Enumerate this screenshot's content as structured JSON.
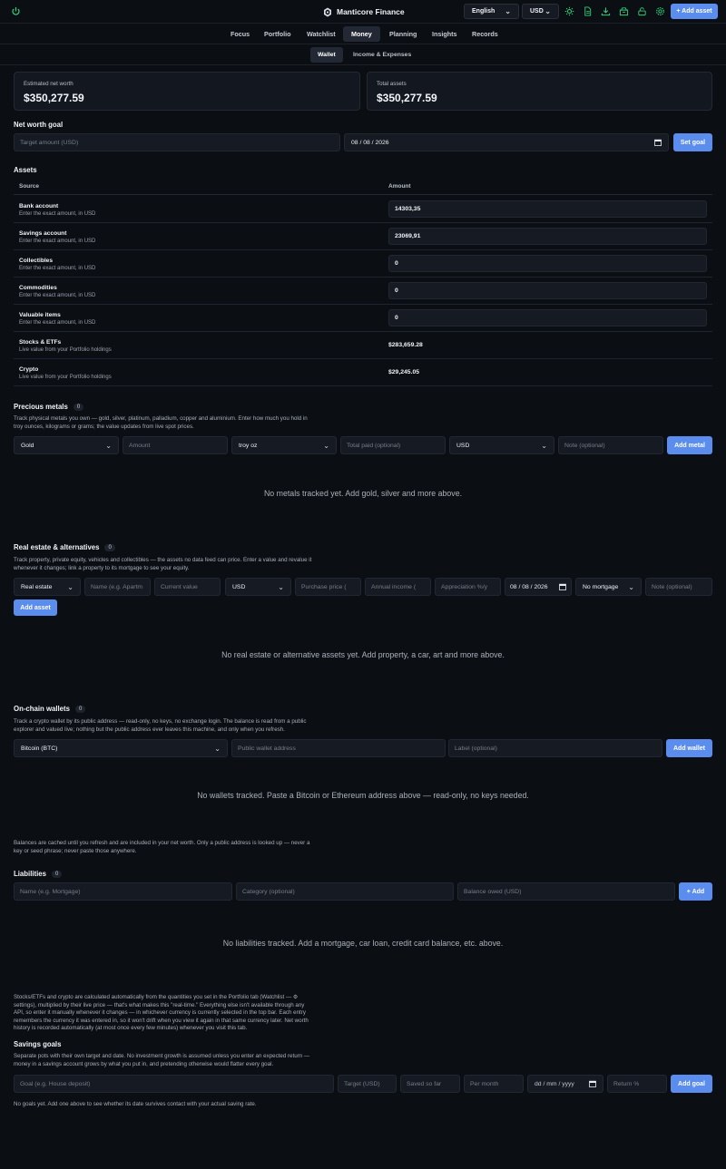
{
  "app": {
    "title": "Manticore Finance",
    "language": "English",
    "currency": "USD",
    "add_asset": "+ Add asset",
    "icons": [
      "power-icon",
      "theme-sun-icon",
      "document-icon",
      "download-icon",
      "inbox-icon",
      "lock-icon",
      "settings-icon"
    ],
    "accent_color": "#5b8def",
    "icon_color": "#2fd27a"
  },
  "nav": {
    "tabs": [
      "Focus",
      "Portfolio",
      "Watchlist",
      "Money",
      "Planning",
      "Insights",
      "Records"
    ],
    "active": "Money",
    "subtabs": [
      "Wallet",
      "Income & Expenses"
    ],
    "active_sub": "Wallet"
  },
  "summary": {
    "net_worth_label": "Estimated net worth",
    "net_worth_value": "$350,277.59",
    "total_assets_label": "Total assets",
    "total_assets_value": "$350,277.59"
  },
  "goal": {
    "title": "Net worth goal",
    "amount_placeholder": "Target amount (USD)",
    "date": "08 / 08 / 2026",
    "button": "Set goal"
  },
  "assets": {
    "title": "Assets",
    "col_source": "Source",
    "col_amount": "Amount",
    "rows": [
      {
        "name": "Bank account",
        "hint": "Enter the exact amount, in USD",
        "value": "14303,35"
      },
      {
        "name": "Savings account",
        "hint": "Enter the exact amount, in USD",
        "value": "23069,91"
      },
      {
        "name": "Collectibles",
        "hint": "Enter the exact amount, in USD",
        "value": "0"
      },
      {
        "name": "Commodities",
        "hint": "Enter the exact amount, in USD",
        "value": "0"
      },
      {
        "name": "Valuable items",
        "hint": "Enter the exact amount, in USD",
        "value": "0"
      },
      {
        "name": "Stocks & ETFs",
        "hint": "Live value from your Portfolio holdings",
        "value": "$283,659.28"
      },
      {
        "name": "Crypto",
        "hint": "Live value from your Portfolio holdings",
        "value": "$29,245.05"
      }
    ]
  },
  "metals": {
    "title": "Precious metals",
    "count": "0",
    "desc1": "Track physical metals you own — gold, silver, platinum, palladium, copper and aluminium. Enter how much you hold in",
    "desc2": "troy ounces, kilograms or grams; the value updates from live spot prices.",
    "metal": "Gold",
    "amount_placeholder": "Amount",
    "unit": "troy oz",
    "paid_placeholder": "Total paid (optional)",
    "currency": "USD",
    "note_placeholder": "Note (optional)",
    "button": "Add metal",
    "empty": "No metals tracked yet. Add gold, silver and more above."
  },
  "realestate": {
    "title": "Real estate & alternatives",
    "count": "0",
    "desc1": "Track property, private equity, vehicles and collectibles — the assets no data feed can price. Enter a value and revalue it",
    "desc2": "whenever it changes; link a property to its mortgage to see your equity.",
    "type": "Real estate",
    "name_placeholder": "Name (e.g. Apartm",
    "value_placeholder": "Current value",
    "currency": "USD",
    "purchase_placeholder": "Purchase price (",
    "income_placeholder": "Annual income (",
    "appreciation_placeholder": "Appreciation %/y",
    "date": "08 / 08 / 2026",
    "mortgage": "No mortgage",
    "note_placeholder": "Note (optional)",
    "button": "Add asset",
    "empty": "No real estate or alternative assets yet. Add property, a car, art and more above."
  },
  "wallets": {
    "title": "On-chain wallets",
    "count": "0",
    "desc1": "Track a crypto wallet by its public address — read-only, no keys, no exchange login. The balance is read from a public",
    "desc2": "explorer and valued live; nothing but the public address ever leaves this machine, and only when you refresh.",
    "chain": "Bitcoin (BTC)",
    "address_placeholder": "Public wallet address",
    "label_placeholder": "Label (optional)",
    "button": "Add wallet",
    "empty": "No wallets tracked. Paste a Bitcoin or Ethereum address above — read-only, no keys needed.",
    "note1": "Balances are cached until you refresh and are included in your net worth. Only a public address is looked up — never a",
    "note2": "key or seed phrase; never paste those anywhere."
  },
  "liabilities": {
    "title": "Liabilities",
    "count": "0",
    "name_placeholder": "Name (e.g. Mortgage)",
    "category_placeholder": "Category (optional)",
    "balance_placeholder": "Balance owed (USD)",
    "button": "+ Add",
    "empty": "No liabilities tracked. Add a mortgage, car loan, credit card balance, etc. above."
  },
  "footnote": {
    "l1": "Stocks/ETFs and crypto are calculated automatically from the quantities you set in the Portfolio tab (Watchlist — ⚙",
    "l2": "settings), multiplied by their live price — that's what makes this \"real-time.\" Everything else isn't available through any",
    "l3": "API, so enter it manually whenever it changes — in whichever currency is currently selected in the top bar. Each entry",
    "l4": "remembers the currency it was entered in, so it won't drift when you view it again in that same currency later. Net worth",
    "l5": "history is recorded automatically (at most once every few minutes) whenever you visit this tab."
  },
  "savings": {
    "title": "Savings goals",
    "desc1": "Separate pots with their own target and date. No investment growth is assumed unless you enter an expected return —",
    "desc2": "money in a savings account grows by what you put in, and pretending otherwise would flatter every goal.",
    "goal_placeholder": "Goal (e.g. House deposit)",
    "target_placeholder": "Target (USD)",
    "saved_placeholder": "Saved so far",
    "month_placeholder": "Per month",
    "date_placeholder": "dd / mm / yyyy",
    "return_placeholder": "Return %",
    "button": "Add goal",
    "empty": "No goals yet. Add one above to see whether its date survives contact with your actual saving rate."
  }
}
